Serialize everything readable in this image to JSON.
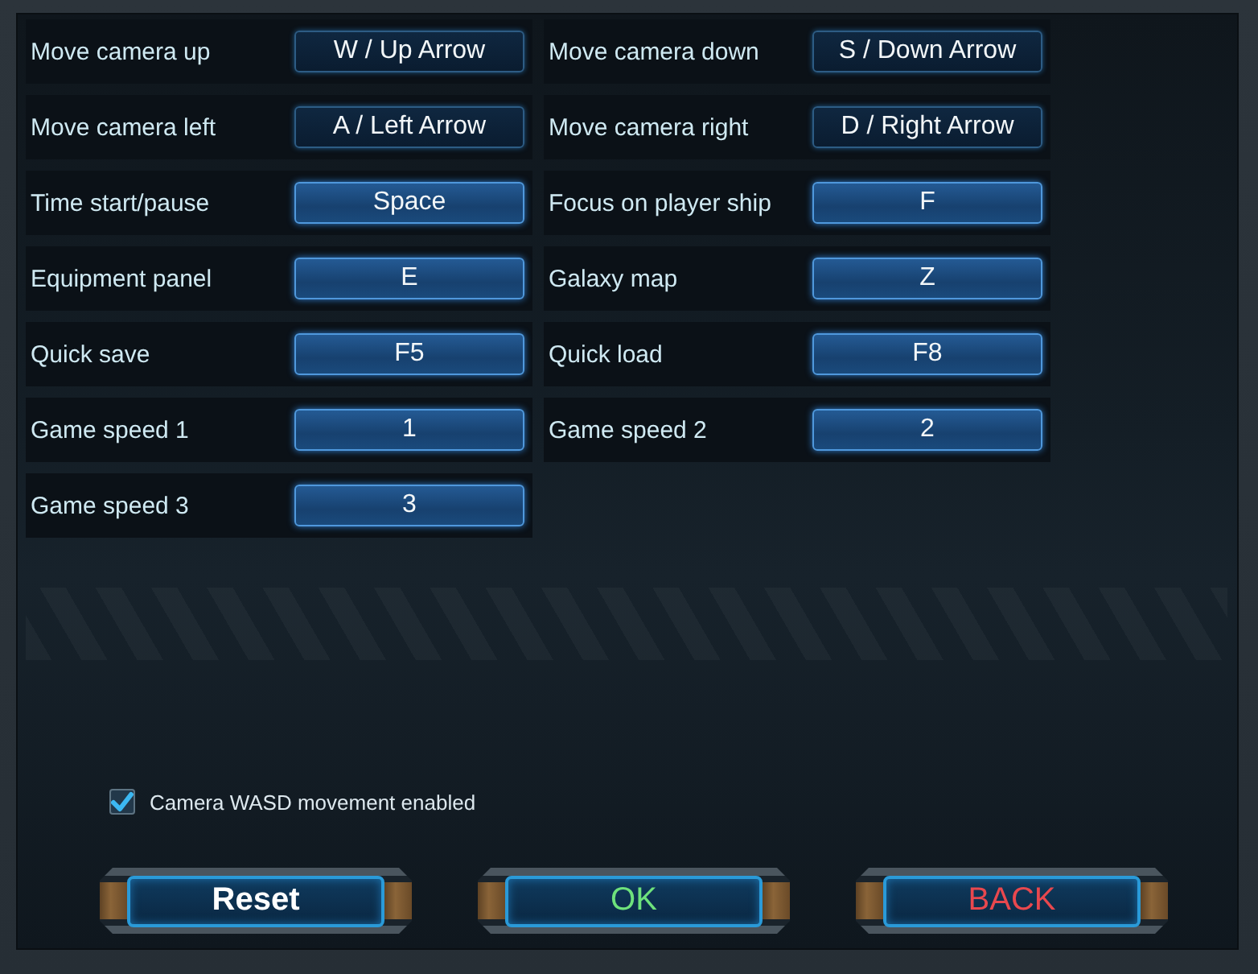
{
  "bindings": [
    {
      "action": "Move camera up",
      "key": "W / Up Arrow",
      "kind": "dual"
    },
    {
      "action": "Move camera down",
      "key": "S / Down Arrow",
      "kind": "dual"
    },
    {
      "action": "Move camera left",
      "key": "A / Left Arrow",
      "kind": "dual"
    },
    {
      "action": "Move camera right",
      "key": "D / Right Arrow",
      "kind": "dual"
    },
    {
      "action": "Time start/pause",
      "key": "Space",
      "kind": "single"
    },
    {
      "action": "Focus on player ship",
      "key": "F",
      "kind": "single"
    },
    {
      "action": "Equipment panel",
      "key": "E",
      "kind": "single"
    },
    {
      "action": "Galaxy map",
      "key": "Z",
      "kind": "single"
    },
    {
      "action": "Quick save",
      "key": "F5",
      "kind": "single"
    },
    {
      "action": "Quick load",
      "key": "F8",
      "kind": "single"
    },
    {
      "action": "Game speed 1",
      "key": "1",
      "kind": "single"
    },
    {
      "action": "Game speed 2",
      "key": "2",
      "kind": "single"
    },
    {
      "action": "Game speed 3",
      "key": "3",
      "kind": "single"
    }
  ],
  "wasd_option": {
    "label": "Camera WASD movement enabled",
    "checked": true
  },
  "buttons": [
    {
      "label": "Reset",
      "kind": "neutral"
    },
    {
      "label": "OK",
      "kind": "confirm"
    },
    {
      "label": "BACK",
      "kind": "cancel"
    }
  ]
}
